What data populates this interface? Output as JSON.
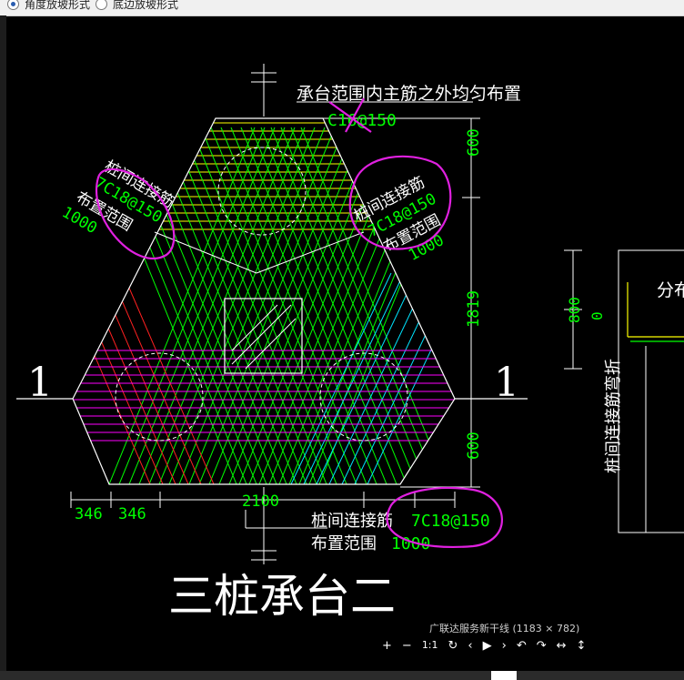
{
  "toolbar": {
    "radio_a": "角度放坡形式",
    "radio_b": "底边放坡形式"
  },
  "drawing": {
    "title": "三桩承台二",
    "note_top": "承台范围内主筋之外均匀布置",
    "note_top_value": "C16@150",
    "left_note1": "桩间连接筋",
    "left_note2": "7C18@150",
    "left_note3": "布置范围",
    "left_note4": "1000",
    "right_note1": "桩间连接筋",
    "right_note2": "7C18@150",
    "right_note3": "布置范围",
    "right_note4": "1000",
    "bottom_note1": "桩间连接筋",
    "bottom_note2": "7C18@150",
    "bottom_note3": "布置范围",
    "bottom_note4": "1000",
    "dim_600_top": "600",
    "dim_1819": "1819",
    "dim_600_bottom": "600",
    "dim_346_a": "346",
    "dim_346_b": "346",
    "dim_2100": "2100",
    "section_left": "1",
    "section_right": "1",
    "side_dim_800": "800",
    "side_dim_0": "0",
    "side_label": "桩间连接筋弯折",
    "side_text": "分布"
  },
  "viewer": {
    "caption": "广联达服务新干线 (1183 × 782)",
    "zoom_in": "+",
    "zoom_out": "−",
    "actual_size": "1:1",
    "refresh": "↻",
    "prev": "‹",
    "play": "▶",
    "next": "›",
    "rotate_left": "↶",
    "rotate_right": "↷",
    "fit_width": "↔",
    "fit_height": "↕"
  },
  "colors": {
    "green": "#00ff00",
    "yellow": "#ffff00",
    "magenta": "#ff00ff",
    "red": "#ff2020",
    "cyan": "#00e5ff",
    "white": "#ffffff",
    "annot": "#e020e0"
  }
}
